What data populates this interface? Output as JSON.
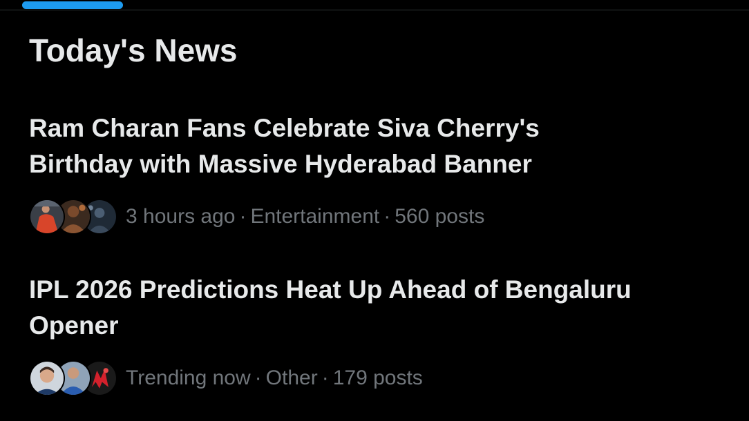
{
  "section": {
    "title": "Today's News"
  },
  "news_items": [
    {
      "headline_line1": "Ram Charan Fans Celebrate Siva Cherry's",
      "headline_line2": "Birthday with Massive Hyderabad Banner",
      "time": "3 hours ago",
      "category": "Entertainment",
      "posts": "560 posts",
      "avatar_icons": [
        "person-red-shirt-avatar",
        "crowd-warm-avatar",
        "crowd-blue-avatar"
      ]
    },
    {
      "headline_line1": "IPL 2026 Predictions Heat Up Ahead of Bengaluru",
      "headline_line2": "Opener",
      "time": "Trending now",
      "category": "Other",
      "posts": "179 posts",
      "avatar_icons": [
        "cricketer-portrait-avatar",
        "cricketer-blue-avatar",
        "team-red-logo-avatar"
      ]
    }
  ],
  "meta": {
    "separator": "·"
  },
  "colors": {
    "background": "#000000",
    "primary_text": "#e7e9ea",
    "secondary_text": "#71767b",
    "accent": "#1d9bf0",
    "divider": "#2f3336"
  }
}
